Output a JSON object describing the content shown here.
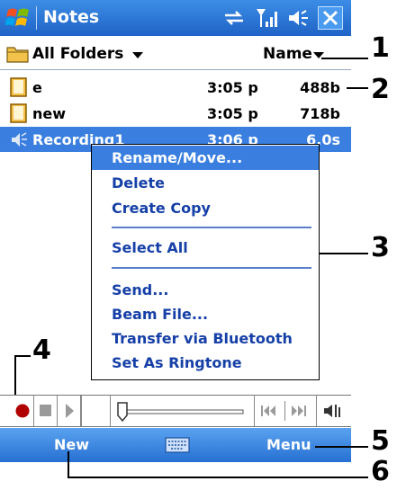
{
  "title_bar": {
    "app_name": "Notes",
    "icons": [
      "windows-start-icon",
      "sync-icon",
      "signal-icon",
      "speaker-icon",
      "close-icon"
    ],
    "accent": "#2a6fd6"
  },
  "folder_bar": {
    "folder_label": "All Folders",
    "sort_label": "Name"
  },
  "files": [
    {
      "name": "e",
      "time": "3:05 p",
      "size": "488b",
      "icon": "note-icon"
    },
    {
      "name": "new",
      "time": "3:05 p",
      "size": "718b",
      "icon": "note-icon"
    },
    {
      "name": "Recording1",
      "time": "3:06 p",
      "size": "6.0s",
      "icon": "speaker-wave-icon",
      "selected": true
    }
  ],
  "context_menu": {
    "items": [
      {
        "label": "Rename/Move...",
        "selected": true
      },
      {
        "label": "Delete"
      },
      {
        "label": "Create Copy"
      },
      {
        "label": "Select All"
      },
      {
        "label": "Send..."
      },
      {
        "label": "Beam File..."
      },
      {
        "label": "Transfer via Bluetooth"
      },
      {
        "label": "Set As Ringtone"
      }
    ]
  },
  "player_bar": {
    "controls": [
      "record-icon",
      "stop-icon",
      "play-icon",
      "position-slider",
      "previous-icon",
      "next-icon",
      "volume-icon"
    ],
    "record_color": "#b00000"
  },
  "menu_bar": {
    "left": "New",
    "right": "Menu",
    "center_icon": "keyboard-icon"
  },
  "callouts": [
    "1",
    "2",
    "3",
    "4",
    "5",
    "6"
  ]
}
